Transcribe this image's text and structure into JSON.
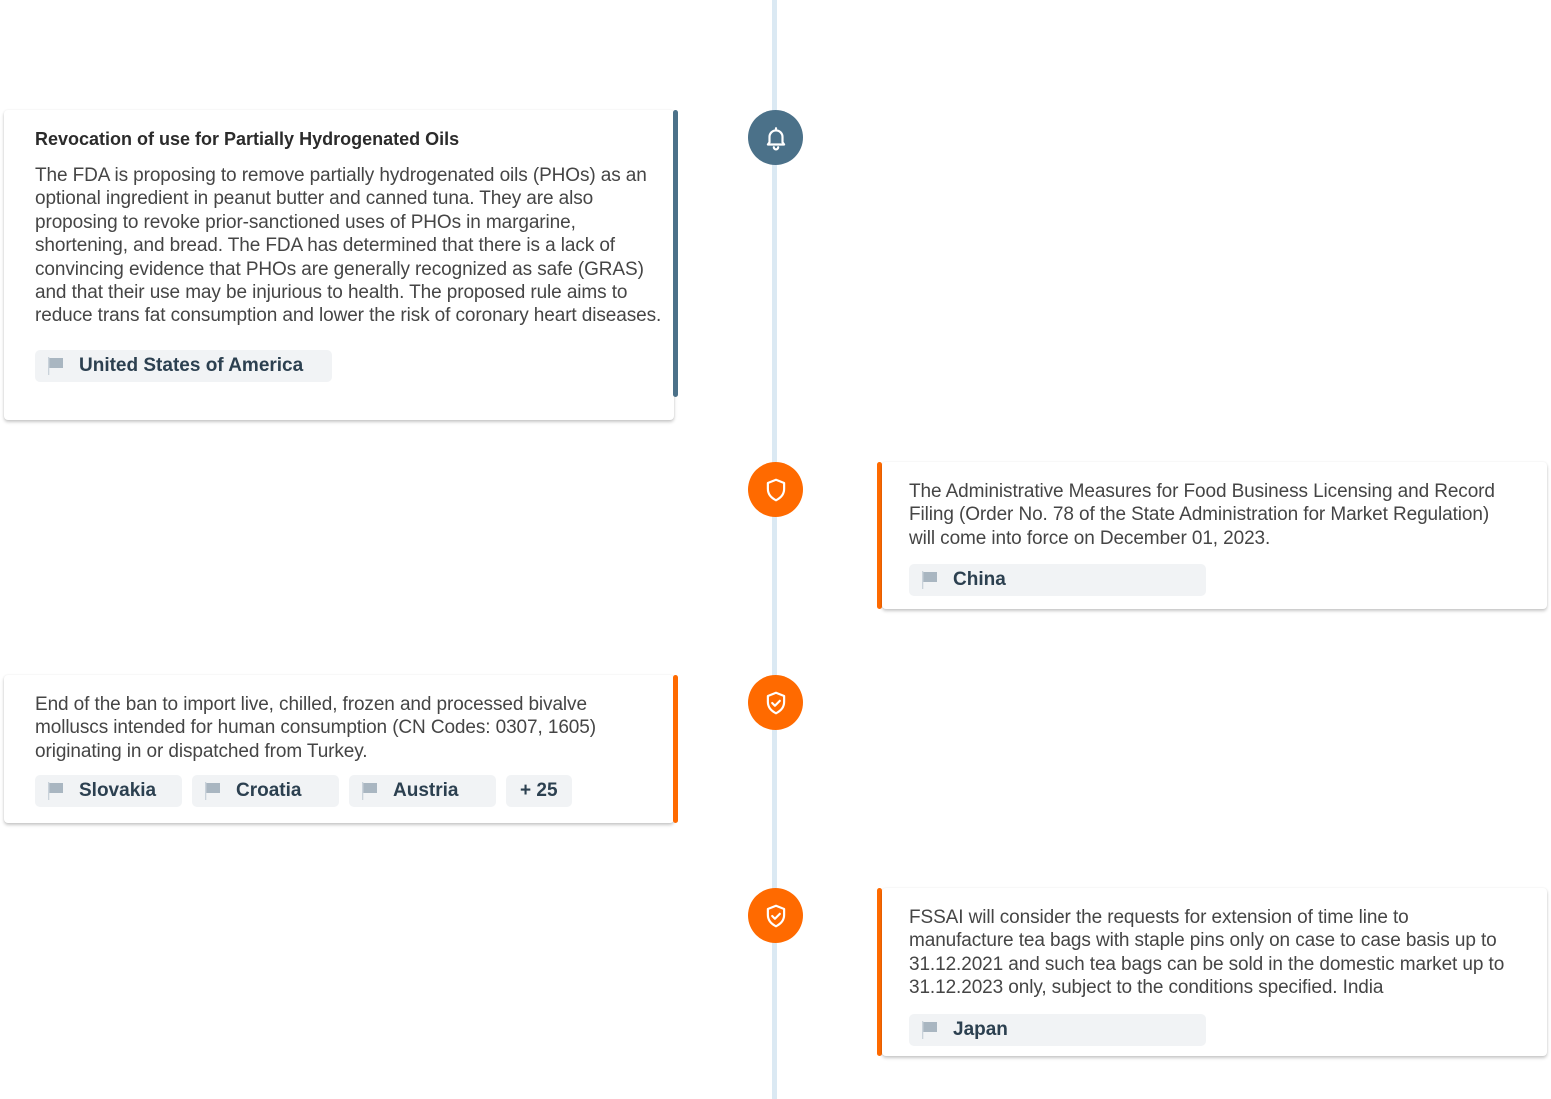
{
  "colors": {
    "timeline": "#dbe9f3",
    "notification_blue": "#4b7189",
    "regulation_orange": "#ff6a00",
    "tag_background": "#f1f3f5",
    "tag_text": "#2c4050",
    "flag_gray": "#a9b6c1"
  },
  "events": [
    {
      "icon": "bell-icon",
      "side": "left",
      "title": "Revocation of use for Partially Hydrogenated Oils",
      "description": "The FDA is proposing to remove partially hydrogenated oils (PHOs) as an optional ingredient in peanut butter and canned tuna. They are also proposing to revoke prior-sanctioned uses of PHOs in margarine, shortening, and bread. The FDA has determined that there is a lack of convincing evidence that PHOs are generally recognized as safe (GRAS) and that their use may be injurious to health. The proposed rule aims to reduce trans fat consumption and lower the risk of coronary heart diseases.",
      "tags": [
        "United States of America"
      ]
    },
    {
      "icon": "shield-icon",
      "side": "right",
      "title": "",
      "description": "The Administrative Measures for Food Business Licensing and Record Filing (Order No. 78 of the State Administration for Market Regulation) will come into force on December 01, 2023.",
      "tags": [
        "China"
      ]
    },
    {
      "icon": "shield-check-icon",
      "side": "left",
      "title": "",
      "description": "End of the ban to import live, chilled, frozen and processed bivalve molluscs intended for human consumption (CN Codes: 0307, 1605) originating in or dispatched from Turkey.",
      "tags": [
        "Slovakia",
        "Croatia",
        "Austria"
      ],
      "more_tags": "+ 25"
    },
    {
      "icon": "shield-check-icon",
      "side": "right",
      "title": "",
      "description": "FSSAI will consider the requests for extension of time line to manufacture tea bags with staple pins only on case to case basis up to 31.12.2021 and such tea bags can be sold in the domestic market up to 31.12.2023 only, subject to the conditions specified. India",
      "tags": [
        "Japan"
      ]
    }
  ]
}
